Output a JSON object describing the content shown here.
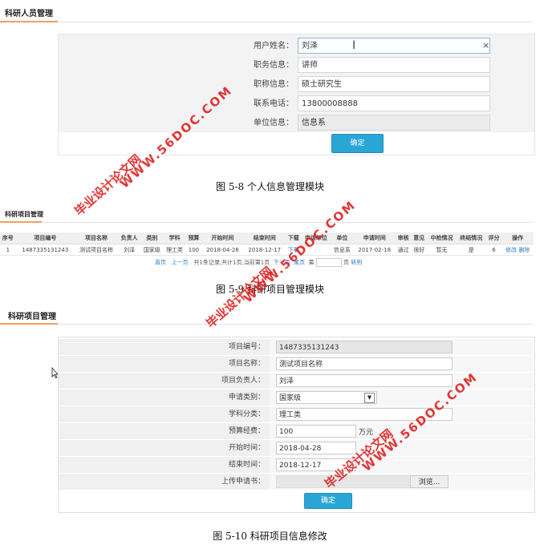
{
  "section1": {
    "title": "科研人员管理",
    "fields": [
      {
        "label": "用户姓名：",
        "value": "刘泽",
        "disabled": false,
        "clearable": true
      },
      {
        "label": "职务信息：",
        "value": "讲师",
        "disabled": false
      },
      {
        "label": "职称信息：",
        "value": "硕士研究生",
        "disabled": false
      },
      {
        "label": "联系电话：",
        "value": "13800008888",
        "disabled": false
      },
      {
        "label": "单位信息：",
        "value": "信息系",
        "disabled": true
      }
    ],
    "submit_label": "确定",
    "clear_glyph": "×",
    "caption": "图 5-8  个人信息管理模块"
  },
  "section2": {
    "title": "科研项目管理",
    "columns": [
      "序号",
      "项目编号",
      "项目名称",
      "负责人",
      "类别",
      "学科",
      "预算",
      "开始时间",
      "结束时间",
      "下载",
      "申请单位",
      "单位",
      "申请时间",
      "审核",
      "意见",
      "中检情况",
      "终结情况",
      "评分",
      "操作"
    ],
    "rows": [
      [
        "1",
        "1487335131243",
        "测试项目名称",
        "刘泽",
        "国家级",
        "理工类",
        "100",
        "2018-04-28",
        "2018-12-17",
        "下载",
        "",
        "信息系",
        "2017-02-18",
        "通过",
        "很好",
        "暂无",
        "是",
        "6",
        "修改 删除"
      ]
    ],
    "pager": {
      "first": "首页",
      "prev": "上一页",
      "info": "共1条记录,共计1页,当前第1页",
      "next": "下一页",
      "last": "尾页",
      "goto_prefix": "第",
      "goto_suffix": "页",
      "goto_button": "转到"
    },
    "caption": "图 5-9  科研项目管理模块"
  },
  "section3": {
    "title": "科研项目管理",
    "fields": [
      {
        "label": "项目编号：",
        "value": "1487335131243",
        "kind": "readonly"
      },
      {
        "label": "项目名称：",
        "value": "测试项目名称",
        "kind": "text"
      },
      {
        "label": "项目负责人：",
        "value": "刘泽",
        "kind": "text"
      },
      {
        "label": "申请类别：",
        "value": "国家级",
        "kind": "select"
      },
      {
        "label": "学科分类：",
        "value": "理工类",
        "kind": "text"
      },
      {
        "label": "预算经费：",
        "value": "100",
        "kind": "short",
        "suffix": "万元"
      },
      {
        "label": "开始时间：",
        "value": "2018-04-28",
        "kind": "short"
      },
      {
        "label": "结束时间：",
        "value": "2018-12-17",
        "kind": "short"
      },
      {
        "label": "上传申请书：",
        "value": "",
        "kind": "file"
      }
    ],
    "browse_label": "浏览...",
    "submit_label": "确定",
    "caption": "图 5-10  科研项目信息修改"
  },
  "watermark": {
    "lines": [
      "毕业设计论文网",
      "WWW.56DOC.COM"
    ],
    "color": "#e02020"
  }
}
